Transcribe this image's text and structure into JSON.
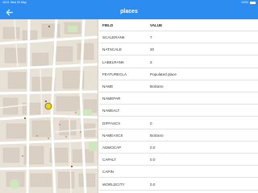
{
  "status_bar": {
    "time": "18:21",
    "date": "Wed 20 May",
    "battery": "100%"
  },
  "nav": {
    "title": "places",
    "back_icon": "back-arrow-icon"
  },
  "colors": {
    "accent": "#2d8cf0",
    "marker": "#f2d40a"
  },
  "table": {
    "columns": [
      "FIELD",
      "VALUE"
    ],
    "rows": [
      {
        "field": "SCALERANK",
        "value": "7"
      },
      {
        "field": "NATSCALE",
        "value": "20"
      },
      {
        "field": "LABELRANK",
        "value": "3"
      },
      {
        "field": "FEATURECLA",
        "value": "Populated place"
      },
      {
        "field": "NAME",
        "value": "Bolzano"
      },
      {
        "field": "NAMEPAR",
        "value": ""
      },
      {
        "field": "NAMEALT",
        "value": ""
      },
      {
        "field": "DIFFASCII",
        "value": "0"
      },
      {
        "field": "NAMEASCII",
        "value": "Bolzano"
      },
      {
        "field": "ADMOCAP",
        "value": "0.0"
      },
      {
        "field": "CAPALT",
        "value": "0.0"
      },
      {
        "field": "CAPIN",
        "value": ""
      },
      {
        "field": "WORLDCITY",
        "value": "0.0"
      }
    ]
  }
}
